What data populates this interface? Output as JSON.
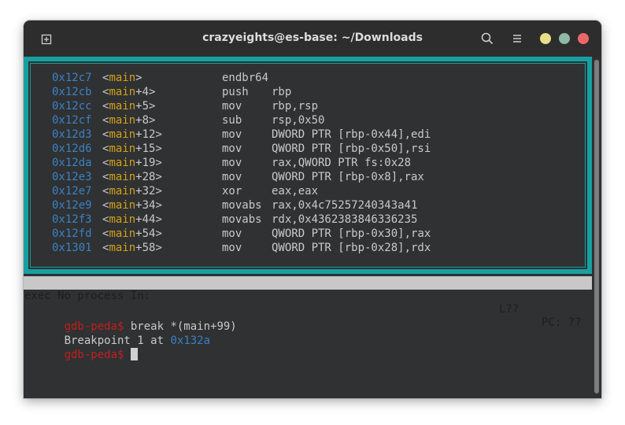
{
  "window": {
    "title": "crazyeights@es-base: ~/Downloads"
  },
  "titlebar_icons": [
    "new-tab-icon",
    "search-icon",
    "hamburger-menu-icon",
    "minimize-icon",
    "maximize-icon",
    "close-icon"
  ],
  "asm": {
    "lines": [
      {
        "addr": "0x12c7",
        "open": "<",
        "fn": "main",
        "rest": ">",
        "mnem": "endbr64",
        "ops": ""
      },
      {
        "addr": "0x12cb",
        "open": "<",
        "fn": "main",
        "rest": "+4>",
        "mnem": "push",
        "ops": "rbp"
      },
      {
        "addr": "0x12cc",
        "open": "<",
        "fn": "main",
        "rest": "+5>",
        "mnem": "mov",
        "ops": "rbp,rsp"
      },
      {
        "addr": "0x12cf",
        "open": "<",
        "fn": "main",
        "rest": "+8>",
        "mnem": "sub",
        "ops": "rsp,0x50"
      },
      {
        "addr": "0x12d3",
        "open": "<",
        "fn": "main",
        "rest": "+12>",
        "mnem": "mov",
        "ops": "DWORD PTR [rbp-0x44],edi"
      },
      {
        "addr": "0x12d6",
        "open": "<",
        "fn": "main",
        "rest": "+15>",
        "mnem": "mov",
        "ops": "QWORD PTR [rbp-0x50],rsi"
      },
      {
        "addr": "0x12da",
        "open": "<",
        "fn": "main",
        "rest": "+19>",
        "mnem": "mov",
        "ops": "rax,QWORD PTR fs:0x28"
      },
      {
        "addr": "0x12e3",
        "open": "<",
        "fn": "main",
        "rest": "+28>",
        "mnem": "mov",
        "ops": "QWORD PTR [rbp-0x8],rax"
      },
      {
        "addr": "0x12e7",
        "open": "<",
        "fn": "main",
        "rest": "+32>",
        "mnem": "xor",
        "ops": "eax,eax"
      },
      {
        "addr": "0x12e9",
        "open": "<",
        "fn": "main",
        "rest": "+34>",
        "mnem": "movabs",
        "ops": "rax,0x4c75257240343a41"
      },
      {
        "addr": "0x12f3",
        "open": "<",
        "fn": "main",
        "rest": "+44>",
        "mnem": "movabs",
        "ops": "rdx,0x4362383846336235"
      },
      {
        "addr": "0x12fd",
        "open": "<",
        "fn": "main",
        "rest": "+54>",
        "mnem": "mov",
        "ops": "QWORD PTR [rbp-0x30],rax"
      },
      {
        "addr": "0x1301",
        "open": "<",
        "fn": "main",
        "rest": "+58>",
        "mnem": "mov",
        "ops": "QWORD PTR [rbp-0x28],rdx"
      }
    ]
  },
  "status": {
    "left": "exec No process In:",
    "line": "L??",
    "pc": "PC: ??"
  },
  "console": {
    "prompt": "gdb-peda$",
    "command": " break *(main+99)",
    "output_text": "Breakpoint 1 at ",
    "output_addr": "0x132a"
  },
  "colors": {
    "tui_border": "#17a0a0",
    "address": "#3b82c4",
    "function": "#d4a017",
    "prompt": "#c51e1e"
  }
}
